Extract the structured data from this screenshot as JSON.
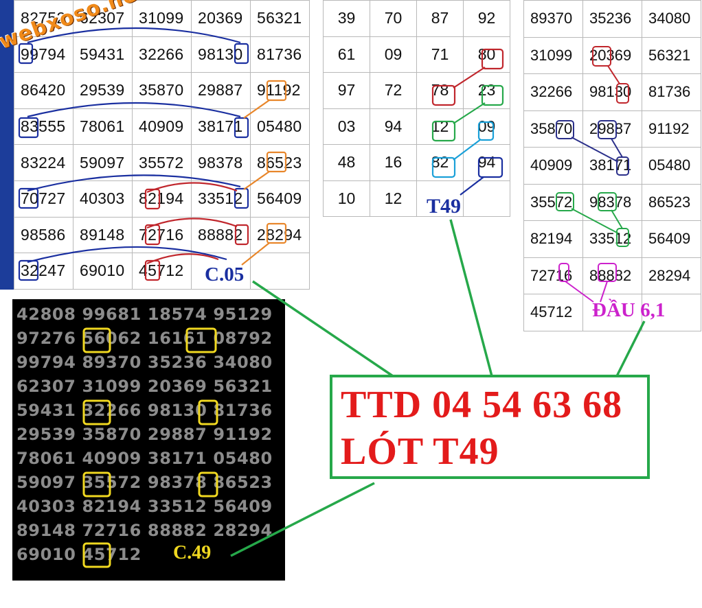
{
  "watermark": "webxoso.net",
  "left_grid": {
    "rows": [
      [
        "82752",
        "62307",
        "31099",
        "20369",
        "56321"
      ],
      [
        "99794",
        "59431",
        "32266",
        "98130",
        "81736"
      ],
      [
        "86420",
        "29539",
        "35870",
        "29887",
        "91192"
      ],
      [
        "83555",
        "78061",
        "40909",
        "38171",
        "05480"
      ],
      [
        "83224",
        "59097",
        "35572",
        "98378",
        "86523"
      ],
      [
        "70727",
        "40303",
        "82194",
        "33512",
        "56409"
      ],
      [
        "98586",
        "89148",
        "72716",
        "88882",
        "28294"
      ],
      [
        "32247",
        "69010",
        "45712",
        "",
        ""
      ]
    ],
    "caption": "C.05"
  },
  "middle_grid": {
    "rows": [
      [
        "39",
        "70",
        "87",
        "92"
      ],
      [
        "61",
        "09",
        "71",
        "80"
      ],
      [
        "97",
        "72",
        "78",
        "23"
      ],
      [
        "03",
        "94",
        "12",
        "09"
      ],
      [
        "48",
        "16",
        "82",
        "94"
      ],
      [
        "10",
        "12",
        "",
        ""
      ]
    ],
    "caption": "T49"
  },
  "right_grid": {
    "rows": [
      [
        "89370",
        "35236",
        "34080"
      ],
      [
        "31099",
        "20369",
        "56321"
      ],
      [
        "32266",
        "98130",
        "81736"
      ],
      [
        "35870",
        "29887",
        "91192"
      ],
      [
        "40909",
        "38171",
        "05480"
      ],
      [
        "35572",
        "98378",
        "86523"
      ],
      [
        "82194",
        "33512",
        "56409"
      ],
      [
        "72716",
        "88882",
        "28294"
      ],
      [
        "45712",
        "",
        ""
      ]
    ],
    "caption": "ĐẦU 6,1"
  },
  "black_panel": {
    "rows": [
      "42808 99681 18574 95129",
      "97276 56062 16161 08792",
      "99794 89370 35236 34080",
      "62307 31099 20369 56321",
      "59431 32266 98130 81736",
      "29539 35870 29887 91192",
      "78061 40909 38171 05480",
      "59097 35572 98378 86523",
      "40303 82194 33512 56409",
      "89148 72716 88882 28294",
      "69010 45712"
    ],
    "caption": "C.49"
  },
  "result_box": {
    "line1": "TTD 04 54 63 68",
    "line2": "LÓT T49"
  },
  "colors": {
    "blue": "#1a2fa0",
    "orange": "#e8862a",
    "red": "#c0262c",
    "green": "#26a84a",
    "cyan": "#1aa0d8",
    "navy": "#2a2f8a",
    "magenta": "#cc22cc",
    "yellow": "#f0d820",
    "result_red": "#e31b1b"
  }
}
